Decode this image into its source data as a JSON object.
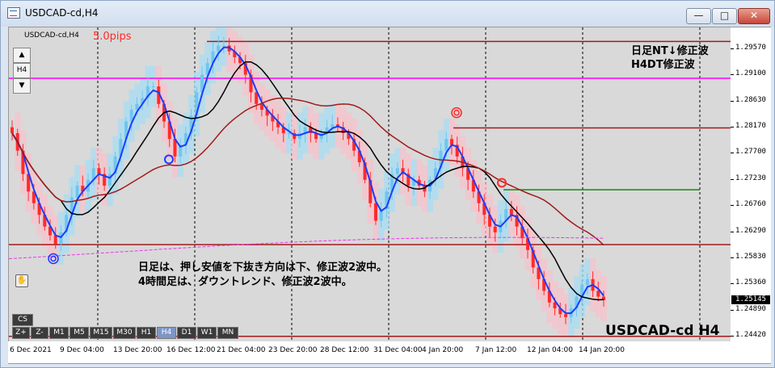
{
  "window": {
    "title": "USDCAD-cd,H4",
    "minimize_glyph": "—",
    "maximize_glyph": "□",
    "close_glyph": "✕"
  },
  "chart": {
    "symbol_label": "USDCAD-cd,H4",
    "pips_label": "5.0pips",
    "note_top_line1": "日足NT↓修正波",
    "note_top_line2": "H4DT修正波",
    "note_mid_line1": "日足は、押し安値を下抜き方向は下、修正波2波中。",
    "note_mid_line2": "4時間足は、ダウントレンド、修正波2波中。",
    "symbol_bottom": "USDCAD-cd H4",
    "nav_up": "▲",
    "nav_tf": "H4",
    "nav_down": "▼",
    "hand_icon": "hand-icon",
    "cs_label": "CS"
  },
  "timeframes": [
    "Z+",
    "Z-",
    "M1",
    "M5",
    "M15",
    "M30",
    "H1",
    "H4",
    "D1",
    "W1",
    "MN"
  ],
  "active_timeframe": "H4",
  "price_axis": {
    "labels": [
      "1.29570",
      "1.29100",
      "1.28630",
      "1.28170",
      "1.27700",
      "1.27230",
      "1.26760",
      "1.26290",
      "1.25830",
      "1.25360",
      "1.24890",
      "1.24420"
    ],
    "current_price": "1.25145"
  },
  "time_axis": {
    "labels": [
      "6 Dec 2021",
      "9 Dec 04:00",
      "13 Dec 20:00",
      "16 Dec 12:00",
      "21 Dec 04:00",
      "23 Dec 20:00",
      "28 Dec 12:00",
      "31 Dec 04:00",
      "4 Jan 20:00",
      "7 Jan 12:00",
      "12 Jan 04:00",
      "14 Jan 20:00"
    ]
  },
  "colors": {
    "bull_candle": "#6ec6f0",
    "bear_candle": "#ff2a2a",
    "bull_zone": "#a8dcf2",
    "bear_zone": "#f7c1cb",
    "ma_fast": "#1a3cff",
    "ma_mid": "#000000",
    "ma_slow": "#a11b1b",
    "ma_long": "#ee33ee",
    "magenta_line": "#ff00ff",
    "level_line": "#a11b1b",
    "green_line": "#138a13"
  },
  "chart_data": {
    "type": "candlestick",
    "ylim": [
      1.2442,
      1.2981
    ],
    "current_price": 1.25145,
    "closes": [
      1.28,
      1.277,
      1.273,
      1.27,
      1.268,
      1.266,
      1.264,
      1.2625,
      1.261,
      1.263,
      1.266,
      1.269,
      1.271,
      1.27,
      1.272,
      1.274,
      1.273,
      1.271,
      1.273,
      1.276,
      1.279,
      1.282,
      1.284,
      1.285,
      1.286,
      1.288,
      1.288,
      1.285,
      1.282,
      1.279,
      1.276,
      1.278,
      1.28,
      1.283,
      1.287,
      1.29,
      1.292,
      1.294,
      1.295,
      1.295,
      1.294,
      1.293,
      1.292,
      1.29,
      1.287,
      1.285,
      1.284,
      1.283,
      1.282,
      1.281,
      1.28,
      1.28,
      1.279,
      1.28,
      1.281,
      1.28,
      1.279,
      1.28,
      1.281,
      1.2815,
      1.281,
      1.28,
      1.279,
      1.277,
      1.275,
      1.272,
      1.268,
      1.265,
      1.267,
      1.27,
      1.273,
      1.274,
      1.273,
      1.271,
      1.272,
      1.271,
      1.27,
      1.272,
      1.274,
      1.277,
      1.279,
      1.278,
      1.276,
      1.274,
      1.272,
      1.27,
      1.268,
      1.266,
      1.264,
      1.263,
      1.265,
      1.267,
      1.266,
      1.264,
      1.262,
      1.26,
      1.257,
      1.255,
      1.253,
      1.251,
      1.25,
      1.249,
      1.2485,
      1.25,
      1.252,
      1.254,
      1.255,
      1.253,
      1.252,
      1.2514
    ],
    "horizontal_levels": [
      1.2957,
      1.2894,
      1.2809,
      1.2703,
      1.2609,
      1.2452
    ],
    "markers": [
      {
        "type": "blue-circle",
        "price": 1.2755
      },
      {
        "type": "blue-double-circle",
        "price": 1.2585
      },
      {
        "type": "red-double-circle",
        "price": 1.2835
      },
      {
        "type": "red-circle",
        "price": 1.2715
      }
    ]
  }
}
